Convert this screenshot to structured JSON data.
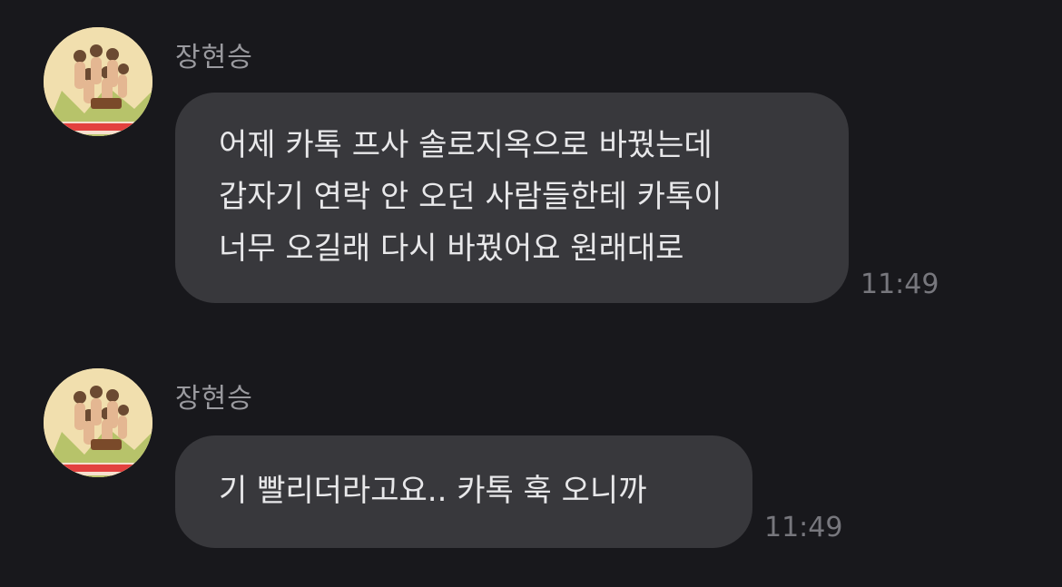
{
  "messages": [
    {
      "sender": "장현승",
      "lines": [
        "어제 카톡 프사 솔로지옥으로 바꿨는데",
        "갑자기 연락 안 오던 사람들한테 카톡이",
        "너무 오길래 다시 바꿨어요 원래대로"
      ],
      "time": "11:49"
    },
    {
      "sender": "장현승",
      "lines": [
        "기 빨리더라고요.. 카톡 훅 오니까"
      ],
      "time": "11:49"
    }
  ],
  "colors": {
    "background": "#18181c",
    "bubble": "#38383c",
    "text": "#e8e8ea",
    "sender": "#9a9a9f",
    "time": "#77777d"
  }
}
